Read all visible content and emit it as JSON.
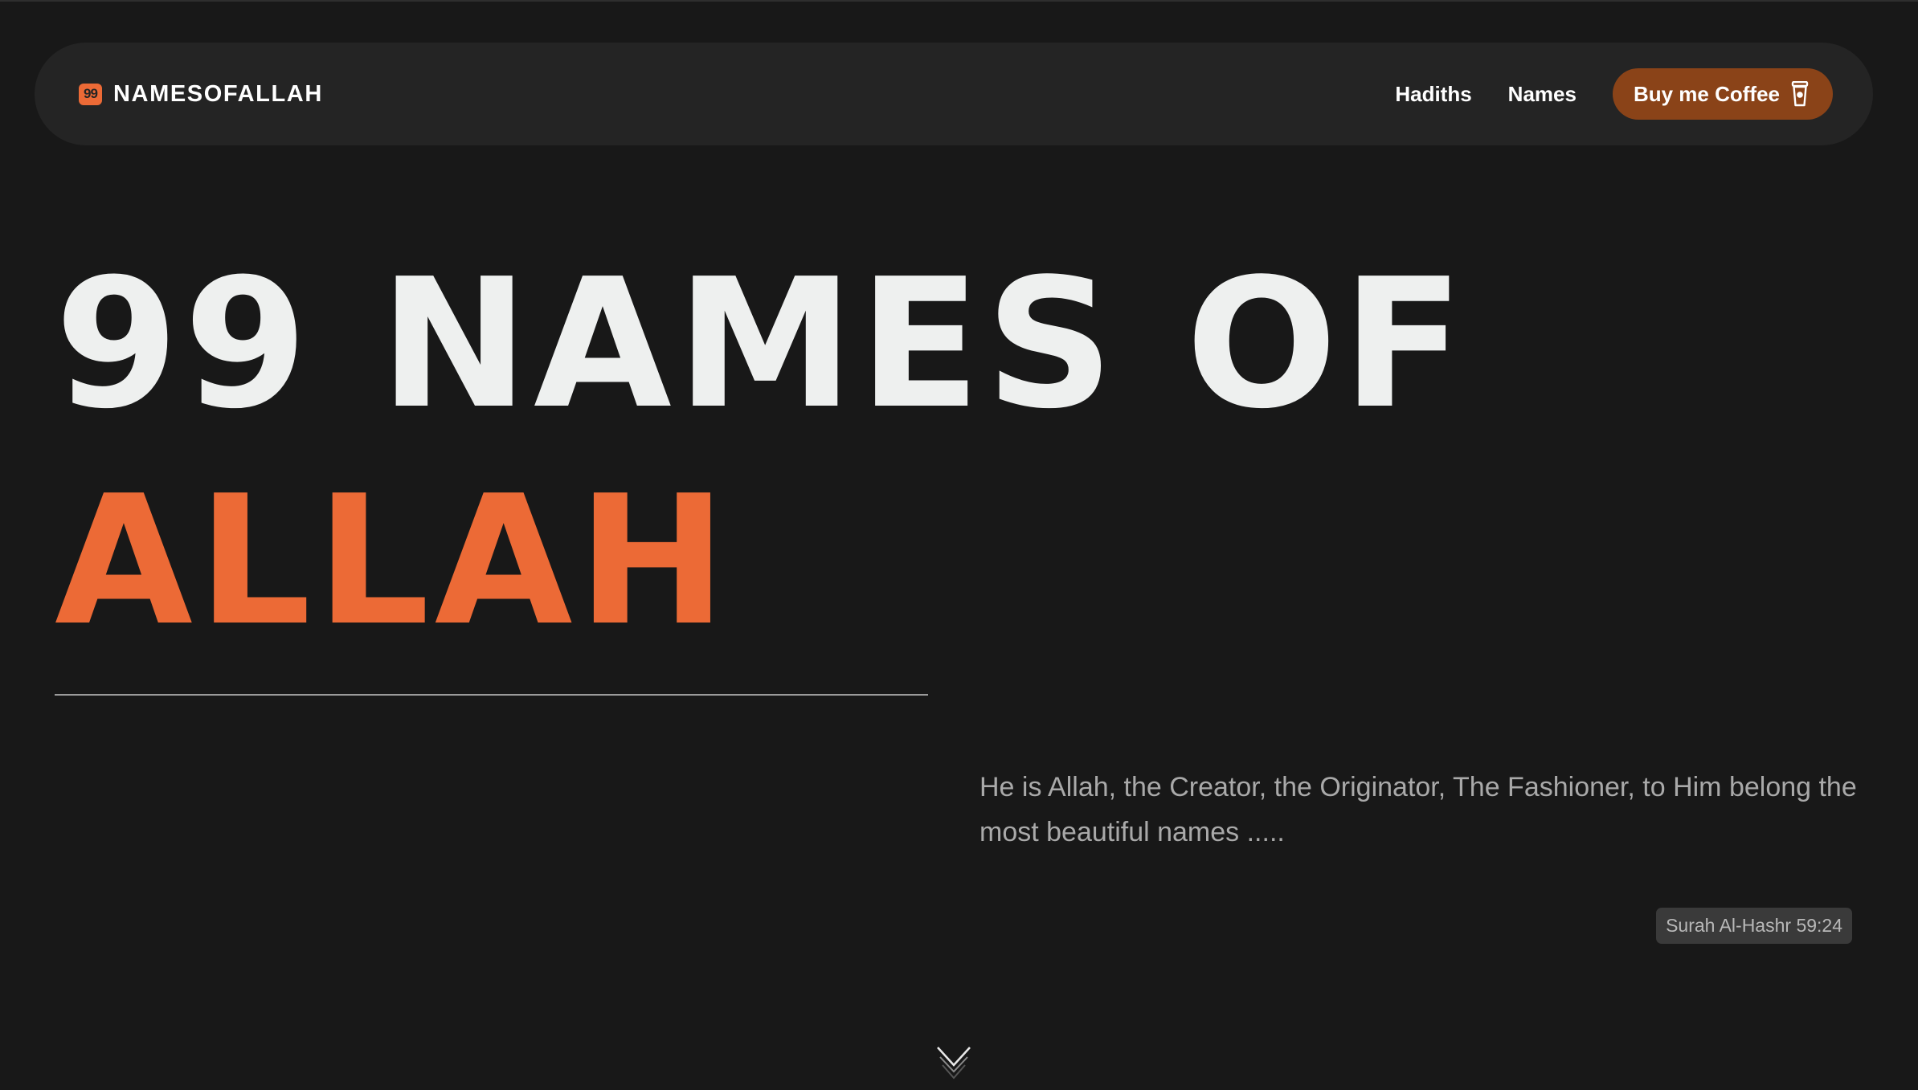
{
  "brand": {
    "icon_glyph": "99",
    "name": "NAMESOFALLAH"
  },
  "nav": {
    "links": [
      "Hadiths",
      "Names"
    ],
    "cta_label": "Buy me Coffee",
    "cta_icon": "coffee-cup-icon"
  },
  "hero": {
    "line1": "99 NAMES OF",
    "line2": "ALLAH"
  },
  "quote": {
    "text": "He is Allah, the Creator, the Originator, The Fashioner, to Him belong the most beautiful names .....",
    "source": "Surah Al-Hashr 59:24"
  },
  "scroll_icon": "chevron-down-icon",
  "colors": {
    "background": "#181818",
    "navbar": "#242424",
    "accent": "#ec6a36",
    "cta": "#8a4318",
    "heading": "#eef0ef",
    "muted_text": "#a9a9a9"
  }
}
